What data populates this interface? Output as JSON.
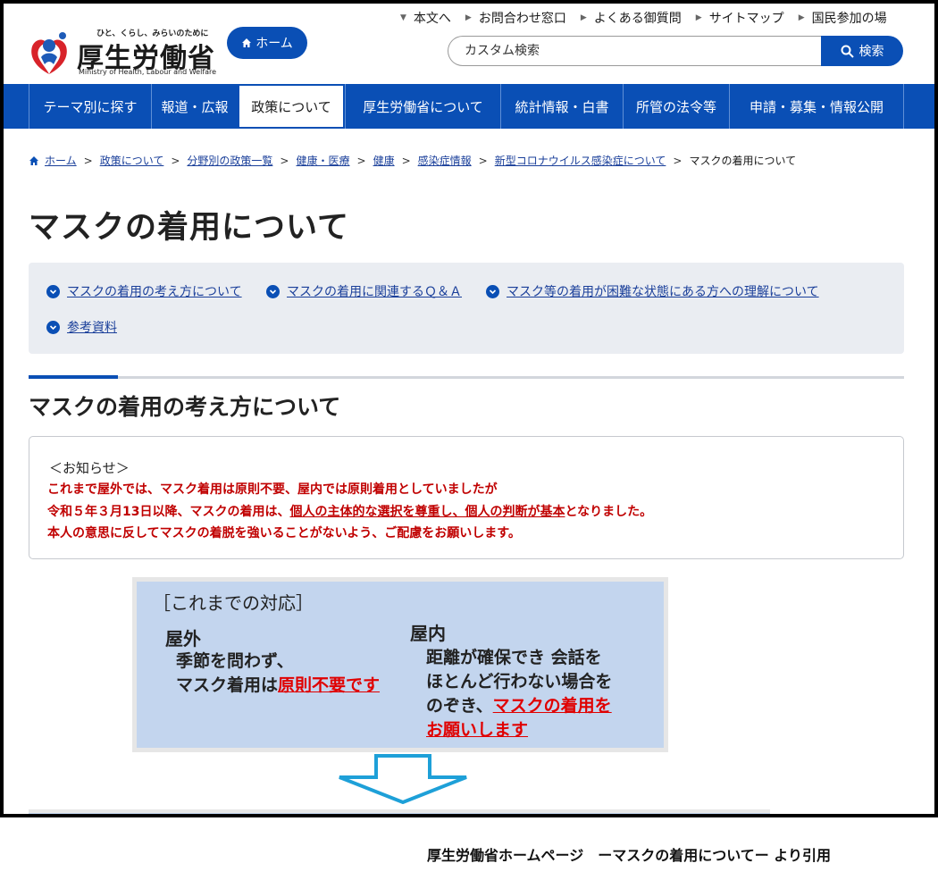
{
  "header": {
    "tagline": "ひと、くらし、みらいのために",
    "site_name": "厚生労働省",
    "site_name_en": "Ministry of Health, Labour and Welfare",
    "home_label": "ホーム",
    "util_links": [
      "本文へ",
      "お問合わせ窓口",
      "よくある御質問",
      "サイトマップ",
      "国民参加の場"
    ],
    "search_placeholder": "カスタム検索",
    "search_button": "検索"
  },
  "gnav": {
    "items": [
      "テーマ別に探す",
      "報道・広報",
      "政策について",
      "厚生労働省について",
      "統計情報・白書",
      "所管の法令等",
      "申請・募集・情報公開"
    ],
    "active": "政策について"
  },
  "breadcrumb": [
    "ホーム",
    "政策について",
    "分野別の政策一覧",
    "健康・医療",
    "健康",
    "感染症情報",
    "新型コロナウイルス感染症について",
    "マスクの着用について"
  ],
  "page_title": "マスクの着用について",
  "toc": [
    "マスクの着用の考え方について",
    "マスクの着用に関連するＱ＆Ａ",
    "マスク等の着用が困難な状態にある方への理解について",
    "参考資料"
  ],
  "section_title": "マスクの着用の考え方について",
  "notice": {
    "heading": "＜お知らせ＞",
    "line1": "これまで屋外では、マスク着用は原則不要、屋内では原則着用としていましたが",
    "line2_a": "令和５年３月13日以降、マスクの着用は、",
    "line2_b": "個人の主体的な選択を尊重し、個人の判断が基本",
    "line2_c": "となりました。",
    "line3": "本人の意思に反してマスクの着脱を強いることがないよう、ご配慮をお願いします。"
  },
  "image": {
    "heading": "［これまでの対応］",
    "outdoor_label": "屋外",
    "outdoor_line1": "季節を問わず、",
    "outdoor_line2_a": "マスク着用は",
    "outdoor_line2_b": "原則不要です",
    "indoor_label": "屋内",
    "indoor_line1": "距離が確保でき 会話を",
    "indoor_line2": "ほとんど行わない場合を",
    "indoor_line3_a": "のぞき、",
    "indoor_line3_b": "マスクの着用を",
    "indoor_line4": "お願いします"
  },
  "caption": "厚生労働省ホームページ　ーマスクの着用についてー より引用",
  "colors": {
    "brand_blue": "#0a4fb5",
    "notice_red": "#c00000",
    "image_bg": "#c3d5ee"
  }
}
